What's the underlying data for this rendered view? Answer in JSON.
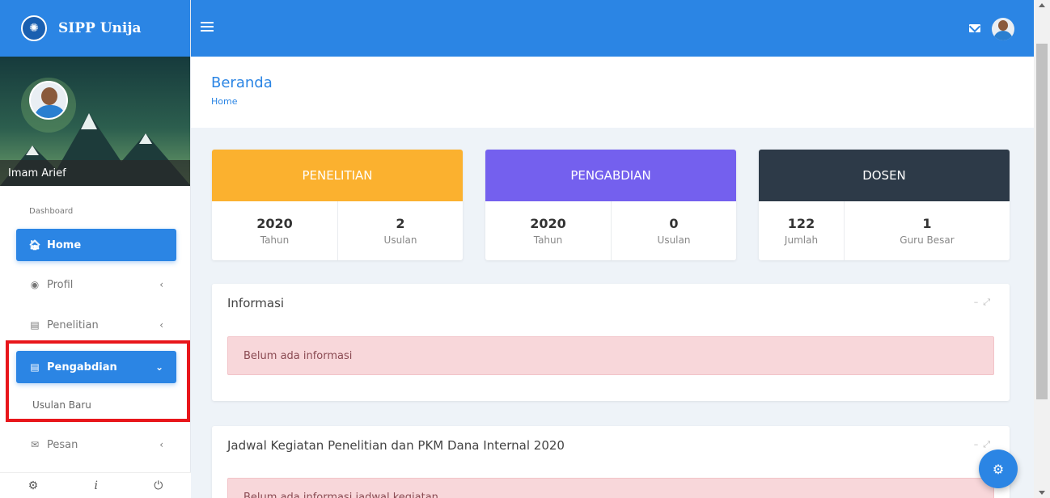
{
  "app": {
    "title": "SIPP Unija"
  },
  "sidebar": {
    "user_name": "Imam Arief",
    "section_label": "Dashboard",
    "items": [
      {
        "label": "Home",
        "icon": "home-icon"
      },
      {
        "label": "Profil",
        "icon": "user-circle-icon"
      },
      {
        "label": "Penelitian",
        "icon": "document-icon"
      },
      {
        "label": "Pengabdian",
        "icon": "document-icon"
      },
      {
        "label": "Pesan",
        "icon": "envelope-icon"
      }
    ],
    "submenu": {
      "label": "Usulan Baru"
    },
    "footer": {
      "info_label": "i"
    }
  },
  "header": {
    "title": "Beranda",
    "breadcrumb": "Home"
  },
  "cards": [
    {
      "title": "PENELITIAN",
      "color": "#fbb12f",
      "stats": [
        {
          "value": "2020",
          "label": "Tahun"
        },
        {
          "value": "2",
          "label": "Usulan"
        }
      ]
    },
    {
      "title": "PENGABDIAN",
      "color": "#7460ee",
      "stats": [
        {
          "value": "2020",
          "label": "Tahun"
        },
        {
          "value": "0",
          "label": "Usulan"
        }
      ]
    },
    {
      "title": "DOSEN",
      "color": "#2d3a48",
      "stats": [
        {
          "value": "122",
          "label": "Jumlah"
        },
        {
          "value": "1",
          "label": "Guru Besar"
        }
      ]
    }
  ],
  "panels": [
    {
      "title": "Informasi",
      "alert": "Belum ada informasi"
    },
    {
      "title": "Jadwal Kegiatan Penelitian dan PKM Dana Internal 2020",
      "alert": "Belum ada informasi jadwal kegiatan"
    }
  ],
  "colors": {
    "primary": "#2b85e4",
    "highlight": "#e8161b"
  }
}
